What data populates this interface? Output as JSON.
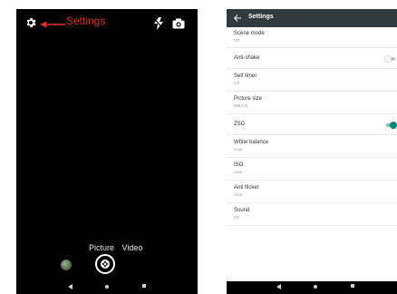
{
  "camera": {
    "annotation_label": "Settings",
    "annotation_color": "#d8322a",
    "modes": [
      "Picture",
      "Video"
    ],
    "icons": {
      "settings": "gear-icon",
      "flash": "flash-icon",
      "switch_camera": "camera-icon",
      "gallery": "gallery-thumbnail",
      "shutter": "shutter-icon"
    }
  },
  "settings": {
    "title": "Settings",
    "items": [
      {
        "title": "Scene mode",
        "subtitle": "Off"
      },
      {
        "title": "Anti-shake",
        "subtitle": "",
        "toggle": "off",
        "toggle_label": "Off"
      },
      {
        "title": "Self timer",
        "subtitle": "Off"
      },
      {
        "title": "Picture size",
        "subtitle": "8M(4:3)"
      },
      {
        "title": "ZSD",
        "subtitle": "",
        "toggle": "on"
      },
      {
        "title": "White balance",
        "subtitle": "Auto"
      },
      {
        "title": "ISO",
        "subtitle": "Auto"
      },
      {
        "title": "Anti flicker",
        "subtitle": "Auto"
      },
      {
        "title": "Sound",
        "subtitle": "On"
      }
    ],
    "accent_color": "#00897b",
    "appbar_color": "#303a3f"
  },
  "nav": {
    "icons": [
      "back-icon",
      "home-icon",
      "recents-icon"
    ]
  }
}
